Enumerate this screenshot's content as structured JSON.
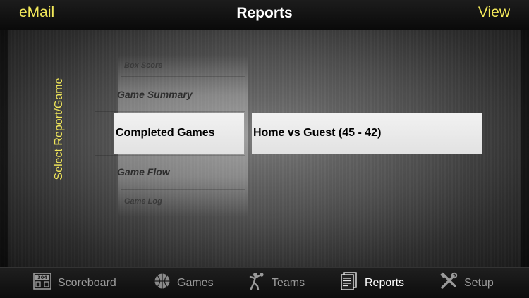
{
  "header": {
    "left_button": "eMail",
    "title": "Reports",
    "right_button": "View"
  },
  "picker": {
    "side_label": "Select Report/Game",
    "reports": [
      "Box Score",
      "Game Summary",
      "Completed Games",
      "Game Flow",
      "Game Log"
    ],
    "selected_report": "Completed Games",
    "selected_game": "Home vs Guest (45 - 42)"
  },
  "tabs": [
    {
      "label": "Scoreboard",
      "icon": "scoreboard-icon"
    },
    {
      "label": "Games",
      "icon": "basketball-icon"
    },
    {
      "label": "Teams",
      "icon": "player-icon"
    },
    {
      "label": "Reports",
      "icon": "reports-icon",
      "active": true
    },
    {
      "label": "Setup",
      "icon": "tools-icon"
    }
  ],
  "colors": {
    "accent_yellow": "#f2e85a",
    "tab_inactive": "#9a9a9a",
    "tab_active": "#ffffff"
  }
}
